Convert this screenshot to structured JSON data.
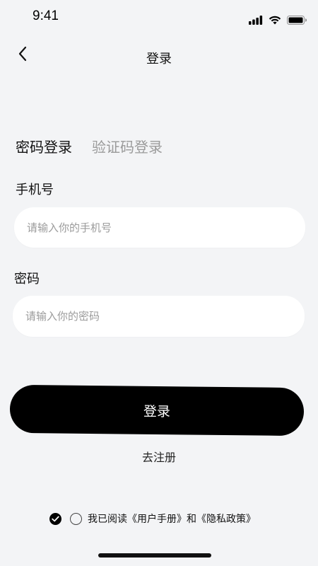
{
  "status_bar": {
    "time": "9:41",
    "icons": [
      "signal-icon",
      "wifi-icon",
      "battery-icon"
    ]
  },
  "nav": {
    "back_icon": "chevron-left-icon",
    "title": "登录"
  },
  "tabs": [
    {
      "label": "密码登录",
      "active": true
    },
    {
      "label": "验证码登录",
      "active": false
    }
  ],
  "form": {
    "phone": {
      "label": "手机号",
      "placeholder": "请输入你的手机号",
      "value": ""
    },
    "password": {
      "label": "密码",
      "placeholder": "请输入你的密码",
      "value": ""
    }
  },
  "login_button": "登录",
  "register_link": "去注册",
  "agreement": {
    "text": "我已阅读《用户手册》和《隐私政策》"
  },
  "colors": {
    "background": "#f3f4f6",
    "button": "#000000",
    "input_bg": "#ffffff",
    "placeholder": "#9b9b9b",
    "inactive_tab": "#9a9a9a"
  }
}
